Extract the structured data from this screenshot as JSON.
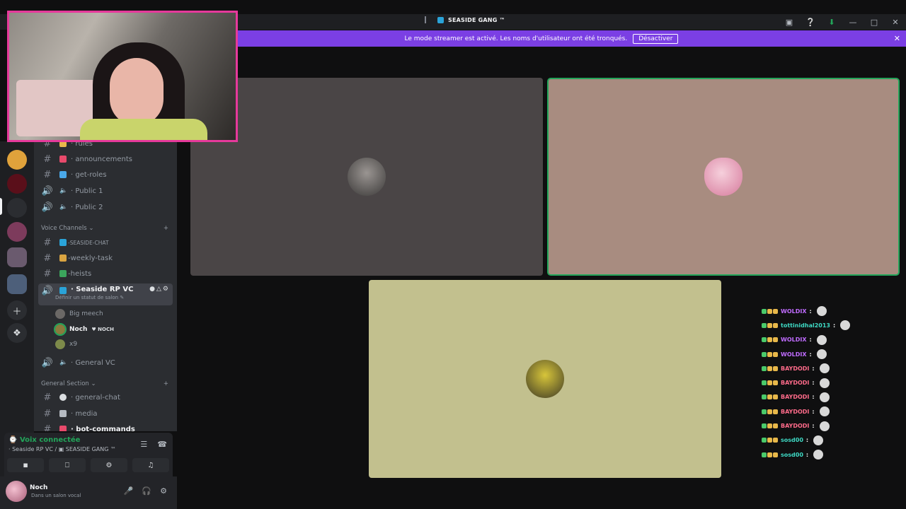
{
  "window": {
    "server_title": "SEASIDE GANG ™",
    "icons": [
      "inbox-icon",
      "help-icon",
      "download-icon",
      "minimize-icon",
      "maximize-icon"
    ]
  },
  "banner": {
    "text": "Le mode streamer est activé. Les noms d'utilisateur ont été tronqués.",
    "button": "Désactiver",
    "close": "✕"
  },
  "channels": {
    "top": [
      {
        "name": "· rules",
        "type": "text",
        "emoji_color": "#e8b84a"
      },
      {
        "name": "· announcements",
        "type": "text",
        "emoji_color": "#e84a6b"
      },
      {
        "name": "· get-roles",
        "type": "text",
        "emoji_color": "#4aa8e8"
      },
      {
        "name": "· Public 1",
        "type": "voice",
        "emoji_color": ""
      },
      {
        "name": "· Public 2",
        "type": "voice",
        "emoji_color": ""
      }
    ],
    "voice_category": "Voice Channels",
    "voice_list": [
      {
        "name": "-SEASIDE-CHAT",
        "type": "text",
        "emoji_color": "#2aa3d8",
        "small": true
      },
      {
        "name": "-weekly-task",
        "type": "text",
        "emoji_color": "#d9a441"
      },
      {
        "name": "-heists",
        "type": "text",
        "emoji_color": "#3ba55c"
      }
    ],
    "active_voice": {
      "name": "· Seaside RP VC",
      "status": "Définir un statut de salon ✎"
    },
    "voice_users": [
      {
        "name": "Big meech",
        "bold": false,
        "tag": ""
      },
      {
        "name": "Noch",
        "bold": true,
        "tag": "♥ NOCH"
      },
      {
        "name": "x9",
        "bold": false,
        "tag": ""
      }
    ],
    "general_vc": "· General VC",
    "general_category": "General Section",
    "general_list": [
      {
        "name": "· general-chat",
        "type": "text",
        "emoji_color": "#dbdee1"
      },
      {
        "name": "· media",
        "type": "text",
        "emoji_color": "#b5bac1"
      },
      {
        "name": "· bot-commands",
        "type": "text",
        "emoji_color": "#e84a6b",
        "bold": true
      }
    ]
  },
  "voice_panel": {
    "status": "Voix connectée",
    "location": "· Seaside RP VC / ▣ SEASIDE GANG ™",
    "buttons": [
      "camera-off-icon",
      "screen-share-icon",
      "activity-icon",
      "soundboard-icon"
    ]
  },
  "user": {
    "name": "Noch",
    "status": "Dans un salon vocal"
  },
  "tiles": [
    {
      "name": "tile-user-1",
      "bg": "#4a4546",
      "avatar": "#6b6866",
      "speaking": false
    },
    {
      "name": "tile-user-2",
      "bg": "#a88c80",
      "avatar": "#e6a8bf",
      "speaking": true
    },
    {
      "name": "tile-user-3",
      "bg": "#c2c08e",
      "avatar": "#8a7a3d",
      "speaking": false
    }
  ],
  "chat": [
    {
      "user": "WOLDIX",
      "color": "#c06cff",
      "colon": ":"
    },
    {
      "user": "tottinidhal2013",
      "color": "#3ed9c4",
      "colon": ":"
    },
    {
      "user": "WOLDIX",
      "color": "#c06cff",
      "colon": ":"
    },
    {
      "user": "WOLDIX",
      "color": "#c06cff",
      "colon": ":"
    },
    {
      "user": "BAYDODI",
      "color": "#ff6b8a",
      "colon": ":"
    },
    {
      "user": "BAYDODI",
      "color": "#ff6b8a",
      "colon": ":"
    },
    {
      "user": "BAYDODI",
      "color": "#ff6b8a",
      "colon": ":"
    },
    {
      "user": "BAYDODI",
      "color": "#ff6b8a",
      "colon": ":"
    },
    {
      "user": "BAYDODI",
      "color": "#ff6b8a",
      "colon": ":"
    },
    {
      "user": "sosd00",
      "color": "#3ed9c4",
      "colon": ":"
    },
    {
      "user": "sosd00",
      "color": "#3ed9c4",
      "colon": ":"
    }
  ]
}
